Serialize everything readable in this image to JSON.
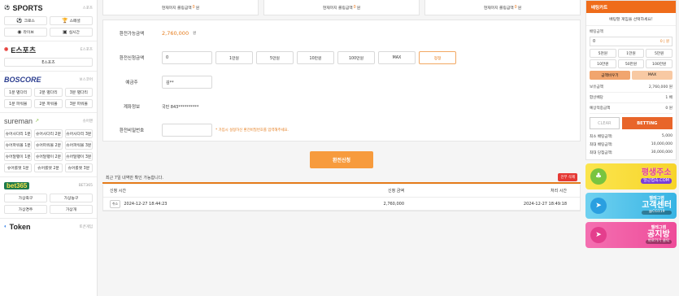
{
  "sidebar": {
    "sports": {
      "title": "SPORTS",
      "sub": "스포츠",
      "items": [
        {
          "icon": "soccer-ball-icon",
          "label": "크로스"
        },
        {
          "icon": "trophy-icon",
          "label": "스페셜"
        },
        {
          "icon": "live-icon",
          "label": "라이브"
        },
        {
          "icon": "tv-icon",
          "label": "실시간"
        }
      ]
    },
    "esports": {
      "title": "E스포츠",
      "sub": "E스포츠",
      "items": [
        "E스포츠"
      ]
    },
    "boscore": {
      "title": "BOSCORE",
      "sub": "보스코어",
      "items": [
        "1분 별다리",
        "2분 별다리",
        "3분 별다리",
        "1분 파워볼",
        "2분 파워볼",
        "3분 파워볼"
      ]
    },
    "sureman": {
      "title": "sureman",
      "sub": "슈어맨",
      "items": [
        "슈어사다리 1분",
        "슈어사다리 2분",
        "슈어사다리 3분",
        "슈어파워볼 1분",
        "슈어파워볼 2분",
        "슈어파워볼 3분",
        "슈어달팽이 1분",
        "슈어달팽이 2분",
        "슈어달팽이 3분",
        "슈어룰렛 1분",
        "슈어룰렛 2분",
        "슈어룰렛 3분"
      ]
    },
    "bet365": {
      "title": "bet365",
      "sub": "BET365",
      "items": [
        "가상축구",
        "가상농구",
        "가상경주",
        "가상개"
      ]
    },
    "token": {
      "title": "Token",
      "sub": "토큰게임"
    }
  },
  "top_boxes": [
    {
      "prefix": "현재까지 롤링금액",
      "amount": "0",
      "suffix": "원"
    },
    {
      "prefix": "현재까지 롤링금액",
      "amount": "0",
      "suffix": "원"
    },
    {
      "prefix": "현재까지 롤링금액",
      "amount": "0",
      "suffix": "원"
    }
  ],
  "form": {
    "available_label": "환전가능금액",
    "available_value": "2,760,000",
    "available_unit": "원",
    "request_label": "환전신청금액",
    "request_value": "0",
    "amount_buttons": [
      "1만원",
      "5만원",
      "10만원",
      "100만원",
      "MAX"
    ],
    "reset_label": "정정",
    "holder_label": "예금주",
    "holder_value": "김**",
    "account_label": "계좌정보",
    "account_value": "국민 843**********",
    "password_label": "환전비밀번호",
    "password_hint": "* 가입시 설정하신 환전비밀번호를 입력해주세요."
  },
  "submit_label": "환전신청",
  "history": {
    "notice": "최근 7일 내역만 확인 가능합니다.",
    "delete_all": "전부 삭제",
    "columns": [
      "신청 시간",
      "신청 금액",
      "처리 시간"
    ],
    "rows": [
      {
        "cancel": "취소",
        "requested": "2024-12-27 18:44:23",
        "amount": "2,760,000",
        "processed": "2024-12-27 18:49:18"
      }
    ]
  },
  "slip": {
    "header": "배팅카트",
    "notice": "배팅할 게임을 선택하세요!",
    "amount_label": "배팅금액",
    "amount_value": "0",
    "amount_unit": "원",
    "quick_buttons": [
      "5천원",
      "1만원",
      "5만원",
      "10만원",
      "50만원",
      "100만원"
    ],
    "reset_label": "금액비우기",
    "max_label": "MAX",
    "held_label": "보유금액",
    "held_value": "2,760,000 원",
    "odds_label": "합산배당",
    "odds_value": "1 배",
    "win_label": "예상적중금액",
    "win_value": "0 원",
    "clear_label": "CLEAR",
    "betting_label": "BETTING",
    "limits": [
      {
        "label": "최소 배팅금액:",
        "value": "5,000"
      },
      {
        "label": "최대 배팅금액:",
        "value": "10,000,000"
      },
      {
        "label": "최대 당첨금액:",
        "value": "30,000,000"
      }
    ]
  },
  "banners": [
    {
      "main": "평생주소",
      "sub": "당근접속.COM"
    },
    {
      "main": "고객센터",
      "top": "텔레그램",
      "sub": "@CG119"
    },
    {
      "main": "공지방",
      "top": "텔레그램",
      "sub": "바로가기 클릭"
    }
  ]
}
